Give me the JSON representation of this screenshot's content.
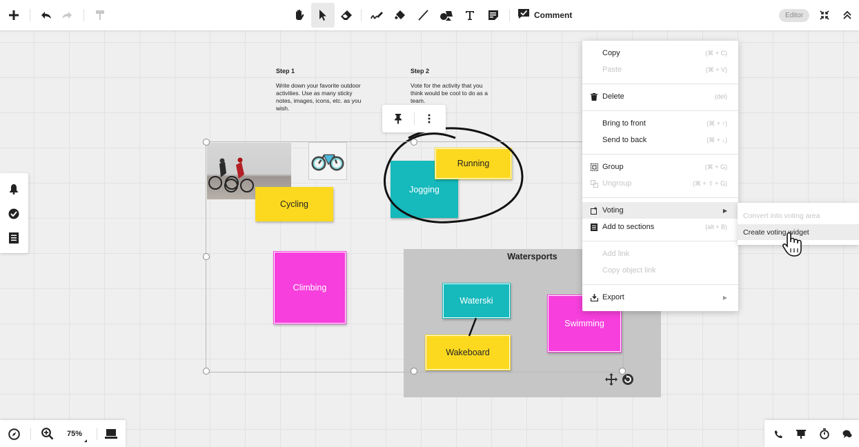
{
  "toolbar": {
    "add_icon": "plus-icon",
    "undo_icon": "undo-icon",
    "redo_icon": "redo-icon",
    "format_painter_icon": "paint-roller-icon",
    "tools": [
      "hand-icon",
      "pointer-icon",
      "eraser-icon",
      "pen-icon",
      "highlighter-icon",
      "line-icon",
      "shapes-icon",
      "text-icon",
      "sticky-note-icon"
    ],
    "comment_label": "Comment",
    "role_badge": "Editor",
    "fullscreen_icon": "collapse-icon",
    "collapse_icon": "chevron-up-double-icon"
  },
  "leftbar": {
    "items": [
      "bell-icon",
      "check-circle-icon",
      "list-icon"
    ]
  },
  "canvas": {
    "step1": {
      "title": "Step 1",
      "text": "Write down your favorite outdoor activities. Use as many sticky notes, images, icons, etc. as you wish."
    },
    "step2": {
      "title": "Step 2",
      "text": "Vote for the activity that you think would be cool to do as a team."
    },
    "notes": {
      "cycling": "Cycling",
      "jogging": "Jogging",
      "running": "Running",
      "climbing": "Climbing",
      "waterski": "Waterski",
      "wakeboard": "Wakeboard",
      "swimming": "Swimming"
    },
    "area_title": "Watersports",
    "colors": {
      "yellow": "#fcd91f",
      "teal": "#16b9bc",
      "pink": "#f63fdc",
      "area": "#c6c6c6"
    }
  },
  "context_menu": {
    "copy": {
      "label": "Copy",
      "shortcut": "(⌘ + C)"
    },
    "paste": {
      "label": "Paste",
      "shortcut": "(⌘ + V)"
    },
    "delete": {
      "label": "Delete",
      "shortcut": "(del)"
    },
    "bring_front": {
      "label": "Bring to front",
      "shortcut": "(⌘ + ↑)"
    },
    "send_back": {
      "label": "Send to back",
      "shortcut": "(⌘ + ↓)"
    },
    "group": {
      "label": "Group",
      "shortcut": "(⌘ + G)"
    },
    "ungroup": {
      "label": "Ungroup",
      "shortcut": "(⌘ + ⇧ + G)"
    },
    "voting": {
      "label": "Voting"
    },
    "sections": {
      "label": "Add to sections",
      "shortcut": "(alt + B)"
    },
    "add_link": {
      "label": "Add link"
    },
    "object_link": {
      "label": "Copy object link"
    },
    "export": {
      "label": "Export"
    }
  },
  "voting_submenu": {
    "convert": "Convert into voting area",
    "create": "Create voting widget"
  },
  "bottom": {
    "zoom": "75%",
    "left_icons": [
      "compass-icon",
      "zoom-in-icon",
      "presentation-icon"
    ],
    "right_icons": [
      "phone-icon",
      "screen-icon",
      "timer-icon",
      "chat-icon"
    ]
  }
}
